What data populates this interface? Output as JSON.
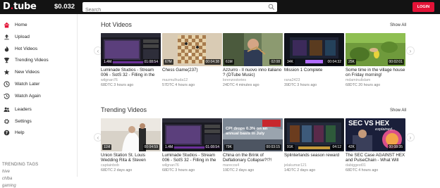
{
  "header": {
    "logo_main": "D",
    "logo_dot": ".",
    "logo_rest": "tube",
    "price": "$0.032",
    "search_placeholder": "Search",
    "login_label": "LOGIN"
  },
  "sidebar": {
    "items": [
      {
        "label": "Home",
        "icon": "home-icon",
        "active": true
      },
      {
        "label": "Upload",
        "icon": "upload-icon"
      },
      {
        "label": "Hot Videos",
        "icon": "fire-icon"
      },
      {
        "label": "Trending Videos",
        "icon": "trophy-icon"
      },
      {
        "label": "New Videos",
        "icon": "star-icon"
      },
      {
        "label": "Watch Later",
        "icon": "clock-icon"
      },
      {
        "label": "Watch Again",
        "icon": "history-icon"
      },
      {
        "label": "Leaders",
        "icon": "users-icon"
      },
      {
        "label": "Settings",
        "icon": "gear-icon"
      },
      {
        "label": "Help",
        "icon": "help-icon"
      }
    ],
    "tags_title": "TRENDING TAGS",
    "tags": [
      "hive",
      "chlba",
      "gaming"
    ]
  },
  "sections": [
    {
      "title": "Hot Videos",
      "show_all": "Show All",
      "videos": [
        {
          "title": "Luminade Studios - Stream 006 - SotS 32 - Filling in the Backstory",
          "author": "wilgnan76",
          "meta": "68DTC 3 hours ago",
          "views": "1.4M",
          "duration": "01:08:54"
        },
        {
          "title": "Chess Game(237)",
          "author": "mazmulhuda12",
          "meta": "57DTC 4 hours ago",
          "views": "67M",
          "duration": "00:04:38"
        },
        {
          "title": "Azzurro - Il nuovo inno italiano ? (DTube Music)",
          "author": "lorenzostories",
          "meta": "24DTC 4 minutes ago",
          "views": "61M",
          "duration": "02:08"
        },
        {
          "title": "Mission 1 Complete",
          "author": "rana2423",
          "meta": "39DTC 3 hours ago",
          "views": "34K",
          "duration": "00:04:32"
        },
        {
          "title": "Some time in the village house on Friday morning!",
          "author": "mdaminulislam",
          "meta": "68DTC 20 hours ago",
          "views": "25K",
          "duration": "00:02:01"
        }
      ]
    },
    {
      "title": "Trending Videos",
      "show_all": "Show All",
      "videos": [
        {
          "title": "Union Station St. Louis Wedding Rita & Steven Wedding Teaser...",
          "author": "captainbob",
          "meta": "68DTC 2 days ago",
          "views": "11M",
          "duration": "00:04:59"
        },
        {
          "title": "Luminade Studios - Stream 006 - SotS 32 - Filling in the Backstory",
          "author": "wilgnan76",
          "meta": "68DTC 3 hours ago",
          "views": "1.4M",
          "duration": "01:08:54"
        },
        {
          "title": "China on the Brink of Deflationary Collapse?!?!",
          "author": "marecos4",
          "meta": "19DTC 2 days ago",
          "views": "79K",
          "duration": "00:03:15",
          "overlay": "CPI drops 0.3% on an annual basis in July"
        },
        {
          "title": "Splinterlands season reward",
          "author": "jelakumar121",
          "meta": "14DTC 2 days ago",
          "views": "91K",
          "duration": "04:12"
        },
        {
          "title": "The SEC Case AGAINST HEX and PulseChain - What Will Happen?",
          "author": "dabiggest01",
          "meta": "68DTC 4 hours ago",
          "views": "42K",
          "duration": "00:08:35",
          "overlay": "SEC VS HEX",
          "overlay2": "explained..."
        }
      ]
    }
  ],
  "colors": {
    "accent": "#e31337",
    "topbar": "#131313"
  }
}
